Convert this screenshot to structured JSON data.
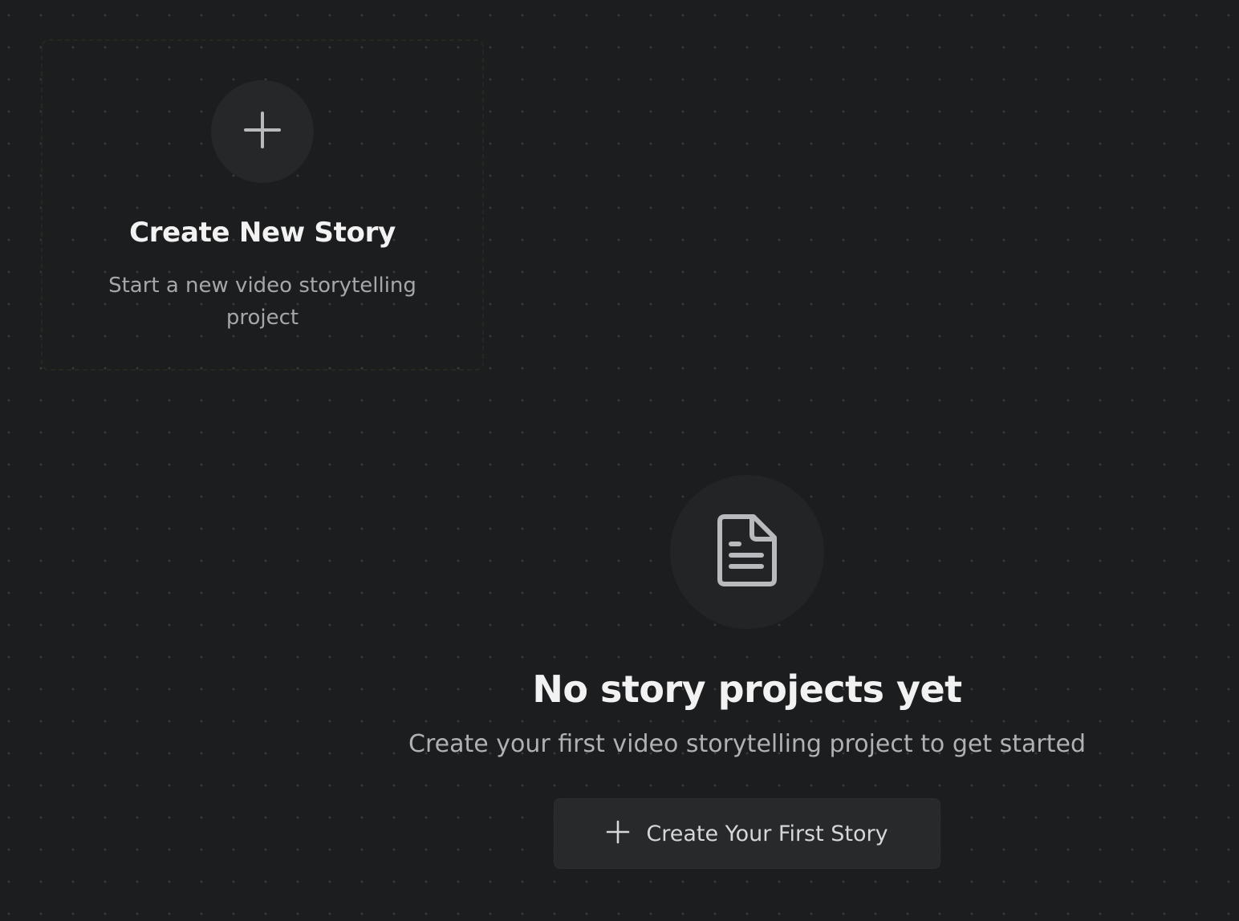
{
  "create_card": {
    "title": "Create New Story",
    "description": "Start a new video storytelling project",
    "icon": "plus-icon"
  },
  "empty_state": {
    "icon": "document-icon",
    "title": "No story projects yet",
    "description": "Create your first video storytelling project to get started",
    "button": {
      "icon": "plus-icon",
      "label": "Create Your First Story"
    }
  },
  "colors": {
    "background": "#1c1d1f",
    "icon_circle": "#262729",
    "button_bg": "#28292b",
    "muted_text": "#a6a7aa"
  }
}
